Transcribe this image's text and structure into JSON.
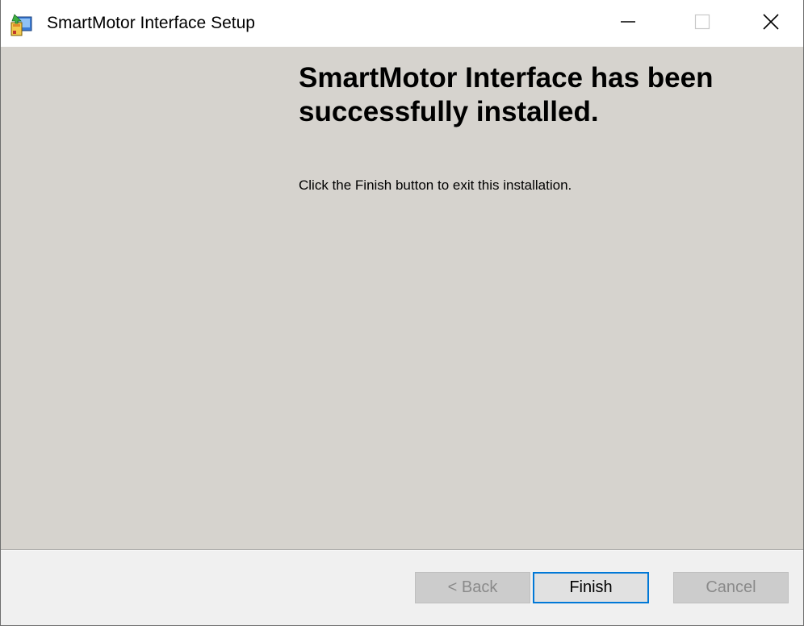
{
  "window": {
    "title": "SmartMotor Interface Setup",
    "app_icon": "installer-icon",
    "controls": {
      "minimize_icon": "minimize-icon",
      "maximize_icon": "maximize-icon",
      "close_icon": "close-icon"
    }
  },
  "content": {
    "heading": "SmartMotor Interface has been successfully installed.",
    "message": "Click the Finish button to exit this installation."
  },
  "buttons": {
    "back": {
      "label": "< Back",
      "enabled": false
    },
    "finish": {
      "label": "Finish",
      "enabled": true,
      "focused": true
    },
    "cancel": {
      "label": "Cancel",
      "enabled": false
    }
  },
  "colors": {
    "content_background": "#d6d3ce",
    "footer_background": "#f0f0f0",
    "focus_border": "#0078d7"
  }
}
